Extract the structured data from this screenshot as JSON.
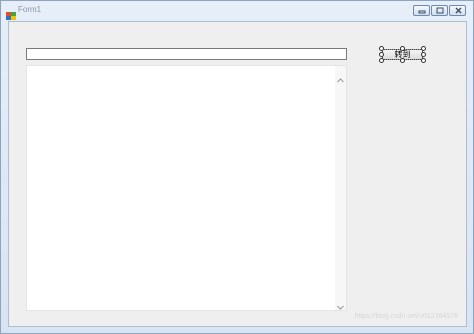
{
  "window": {
    "title": "Form1"
  },
  "form": {
    "textbox_value": "",
    "goto_button_label": "转到",
    "list_items": []
  },
  "watermark": "https://blog.csdn.net/u012384578"
}
